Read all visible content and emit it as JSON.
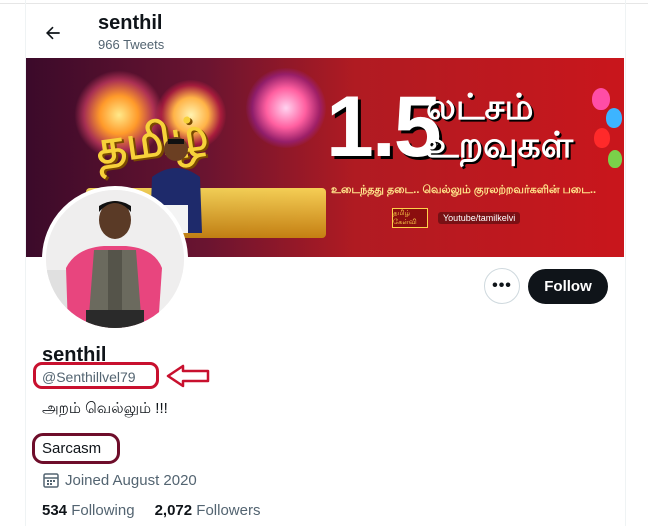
{
  "header": {
    "back_icon": "arrow-left-icon",
    "name": "senthil",
    "tweet_count": "966 Tweets"
  },
  "banner": {
    "big_number": "1.5",
    "headline_line1": "லட்சம்",
    "headline_line2": "உறவுகள்",
    "tamil_gold": "தமிழ்",
    "slogan": "உடைந்தது தடை.. வெல்லும் குரலற்றவர்களின் படை..",
    "youtube": "Youtube/tamilkelvi",
    "logo": "தமிழ் கேள்வி"
  },
  "actions": {
    "more_icon": "more-dots-icon",
    "more_label": "•••",
    "follow_label": "Follow"
  },
  "profile": {
    "display_name": "senthil",
    "handle": "@Senthillvel79",
    "bio": "அறம் வெல்லும் !!!",
    "label": "Sarcasm",
    "joined_icon": "calendar-icon",
    "joined": "Joined August 2020",
    "following_count": "534",
    "following_label": "Following",
    "followers_count": "2,072",
    "followers_label": "Followers"
  },
  "annotations": {
    "handle_highlight_color": "#c8102e",
    "label_highlight_color": "#6e0d2a",
    "arrow_icon": "outline-arrow-left-icon"
  }
}
